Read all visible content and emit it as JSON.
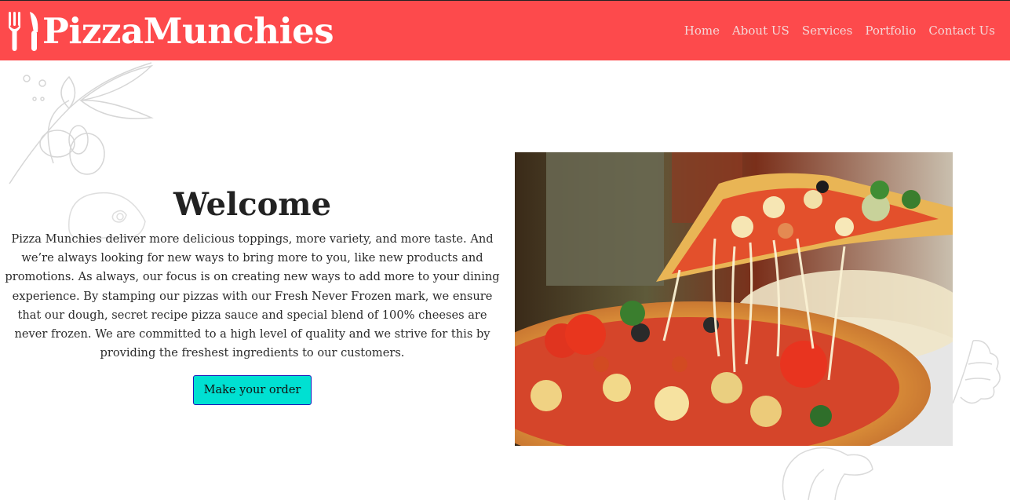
{
  "header": {
    "brand": "PizzaMunchies",
    "logo_icon": "fork-knife-icon",
    "nav": [
      "Home",
      "About US",
      "Services",
      "Portfolio",
      "Contact Us"
    ]
  },
  "hero": {
    "title": "Welcome",
    "body": "Pizza Munchies deliver more delicious toppings, more variety, and more taste. And we’re always looking for new ways to bring more to you, like new products and promotions. As always, our focus is on creating new ways to add more to your dining experience. By stamping our pizzas with our Fresh Never Frozen mark, we ensure that our dough, secret recipe pizza sauce and special blend of 100% cheeses are never frozen. We are committed to a high level of quality and we strive for this by providing the freshest ingredients to our customers.",
    "cta_label": "Make your order",
    "image_subject": "pizza-slice-cheese-pull-photo"
  },
  "colors": {
    "header_bg": "#fd4a4c",
    "cta_bg": "#00e0d2",
    "cta_border": "#1c1ab8"
  }
}
